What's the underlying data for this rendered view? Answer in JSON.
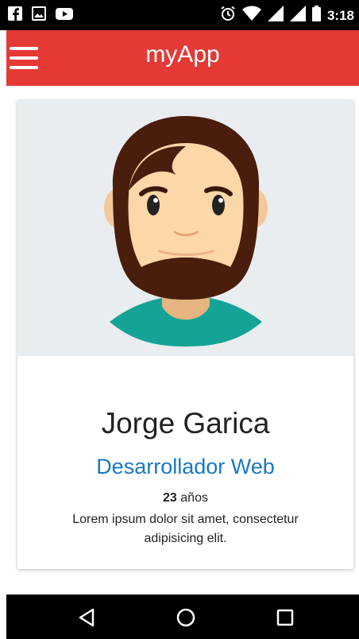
{
  "status_bar": {
    "left_icons": [
      "facebook-icon",
      "image-icon",
      "youtube-icon"
    ],
    "right_icons": [
      "alarm-icon",
      "wifi-icon",
      "signal-icon",
      "signal-icon",
      "battery-icon"
    ],
    "time": "3:18"
  },
  "app_bar": {
    "title": "myApp",
    "menu_icon": "hamburger-menu-icon",
    "color": "#e53935"
  },
  "profile": {
    "name": "Jorge Garica",
    "role": "Desarrollador Web",
    "age_value": "23",
    "age_unit": "años",
    "bio": "Lorem ipsum dolor sit amet, consectetur adipisicing elit.",
    "role_color": "#1a78c2",
    "media_background": "#e9edf0"
  },
  "nav_bar": {
    "buttons": [
      "back-icon",
      "home-icon",
      "recents-icon"
    ]
  }
}
